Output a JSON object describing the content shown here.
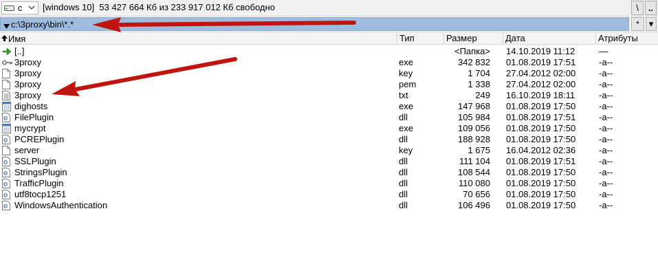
{
  "drivebar": {
    "drive_letter": "c",
    "volume_text": "[windows 10]  53 427 664 Кб из 233 917 012 Кб свободно",
    "root_label": "\\",
    "up_label": ".."
  },
  "pathbar": {
    "path": "c:\\3proxy\\bin\\*.*",
    "filter_label": "*",
    "history_label": "▾"
  },
  "columns": {
    "name": "Имя",
    "type": "Тип",
    "size": "Размер",
    "date": "Дата",
    "attr": "Атрибуты"
  },
  "files": [
    {
      "icon": "parent-folder-arrow-icon",
      "name": "[..]",
      "type": "",
      "size": "<Папка>",
      "date": "14.10.2019 11:12",
      "attr": "—"
    },
    {
      "icon": "key-exe-icon",
      "name": "3proxy",
      "type": "exe",
      "size": "342 832",
      "date": "01.08.2019 17:51",
      "attr": "-a--"
    },
    {
      "icon": "blank-file-icon",
      "name": "3proxy",
      "type": "key",
      "size": "1 704",
      "date": "27.04.2012 02:00",
      "attr": "-a--"
    },
    {
      "icon": "blank-file-icon",
      "name": "3proxy",
      "type": "pem",
      "size": "1 338",
      "date": "27.04.2012 02:00",
      "attr": "-a--"
    },
    {
      "icon": "text-file-icon",
      "name": "3proxy",
      "type": "txt",
      "size": "249",
      "date": "16.10.2019 18:11",
      "attr": "-a--"
    },
    {
      "icon": "exe-file-icon",
      "name": "dighosts",
      "type": "exe",
      "size": "147 968",
      "date": "01.08.2019 17:50",
      "attr": "-a--"
    },
    {
      "icon": "dll-file-icon",
      "name": "FilePlugin",
      "type": "dll",
      "size": "105 984",
      "date": "01.08.2019 17:51",
      "attr": "-a--"
    },
    {
      "icon": "exe-file-icon",
      "name": "mycrypt",
      "type": "exe",
      "size": "109 056",
      "date": "01.08.2019 17:50",
      "attr": "-a--"
    },
    {
      "icon": "dll-file-icon",
      "name": "PCREPlugin",
      "type": "dll",
      "size": "188 928",
      "date": "01.08.2019 17:50",
      "attr": "-a--"
    },
    {
      "icon": "blank-file-icon",
      "name": "server",
      "type": "key",
      "size": "1 675",
      "date": "16.04.2012 02:36",
      "attr": "-a--"
    },
    {
      "icon": "dll-file-icon",
      "name": "SSLPlugin",
      "type": "dll",
      "size": "111 104",
      "date": "01.08.2019 17:51",
      "attr": "-a--"
    },
    {
      "icon": "dll-file-icon",
      "name": "StringsPlugin",
      "type": "dll",
      "size": "108 544",
      "date": "01.08.2019 17:50",
      "attr": "-a--"
    },
    {
      "icon": "dll-file-icon",
      "name": "TrafficPlugin",
      "type": "dll",
      "size": "110 080",
      "date": "01.08.2019 17:50",
      "attr": "-a--"
    },
    {
      "icon": "dll-file-icon",
      "name": "utf8tocp1251",
      "type": "dll",
      "size": "70 656",
      "date": "01.08.2019 17:50",
      "attr": "-a--"
    },
    {
      "icon": "dll-file-icon",
      "name": "WindowsAuthentication",
      "type": "dll",
      "size": "106 496",
      "date": "01.08.2019 17:50",
      "attr": "-a--"
    }
  ],
  "colors": {
    "path_highlight": "#9ebbe0",
    "annotation_arrow": "#c0150f"
  }
}
